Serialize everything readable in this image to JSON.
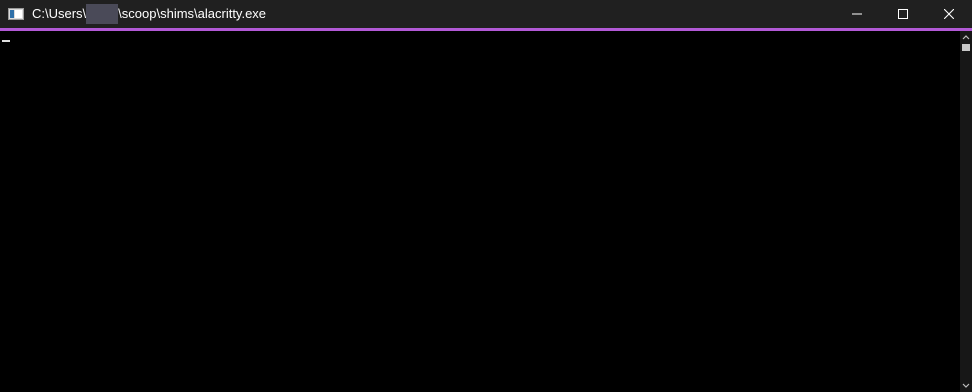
{
  "window": {
    "title_prefix": "C:\\Users\\",
    "title_suffix": "\\scoop\\shims\\alacritty.exe",
    "accent_color": "#b259d6",
    "titlebar_color": "#202020",
    "background_color": "#000000"
  },
  "controls": {
    "minimize_icon": "minimize-icon",
    "maximize_icon": "maximize-icon",
    "close_icon": "close-icon"
  },
  "terminal": {
    "cursor_icon": "cursor-block"
  },
  "scrollbar": {
    "up_icon": "chevron-up-icon",
    "down_icon": "chevron-down-icon",
    "position_fraction": 0.0
  }
}
